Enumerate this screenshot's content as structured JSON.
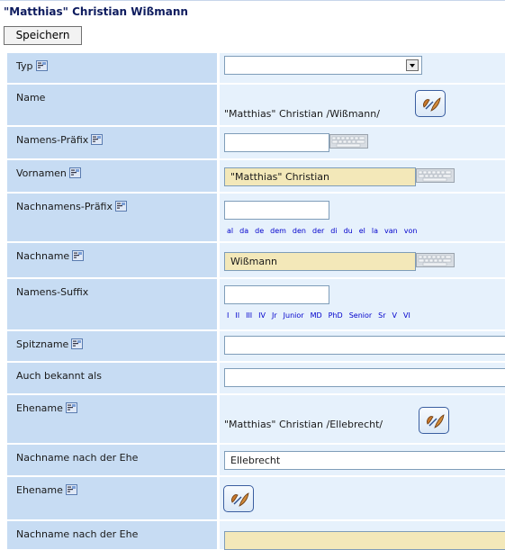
{
  "header": {
    "title": "\"Matthias\" Christian Wißmann",
    "save_label": "Speichern"
  },
  "fields": {
    "typ": {
      "label": "Typ",
      "value": ""
    },
    "name": {
      "label": "Name",
      "value": "\"Matthias\" Christian /Wißmann/"
    },
    "namens_praefix": {
      "label": "Namens-Präfix",
      "value": ""
    },
    "vornamen": {
      "label": "Vornamen",
      "value": "\"Matthias\" Christian"
    },
    "nachnamens_praefix": {
      "label": "Nachnamens-Präfix",
      "value": "",
      "options": [
        "al",
        "da",
        "de",
        "dem",
        "den",
        "der",
        "di",
        "du",
        "el",
        "la",
        "van",
        "von"
      ]
    },
    "nachname": {
      "label": "Nachname",
      "value": "Wißmann"
    },
    "namens_suffix": {
      "label": "Namens-Suffix",
      "value": "",
      "options": [
        "I",
        "II",
        "III",
        "IV",
        "Jr",
        "Junior",
        "MD",
        "PhD",
        "Senior",
        "Sr",
        "V",
        "VI"
      ]
    },
    "spitzname": {
      "label": "Spitzname",
      "value": ""
    },
    "auch_bekannt_als": {
      "label": "Auch bekannt als",
      "value": ""
    },
    "ehename_1": {
      "label": "Ehename",
      "value": "\"Matthias\" Christian /Ellebrecht/"
    },
    "nachname_nach_ehe_1": {
      "label": "Nachname nach der Ehe",
      "value": "Ellebrecht"
    },
    "ehename_2": {
      "label": "Ehename",
      "value": ""
    },
    "nachname_nach_ehe_2": {
      "label": "Nachname nach der Ehe",
      "value": ""
    }
  },
  "icons": {
    "help": "help-icon",
    "keyboard": "keyboard-icon",
    "picker": "edit-name-icon"
  },
  "colors": {
    "label_bg": "#c7dcf3",
    "value_bg": "#e6f1fc",
    "highlight_input": "#f3e8b9",
    "title": "#0d1b5e"
  }
}
